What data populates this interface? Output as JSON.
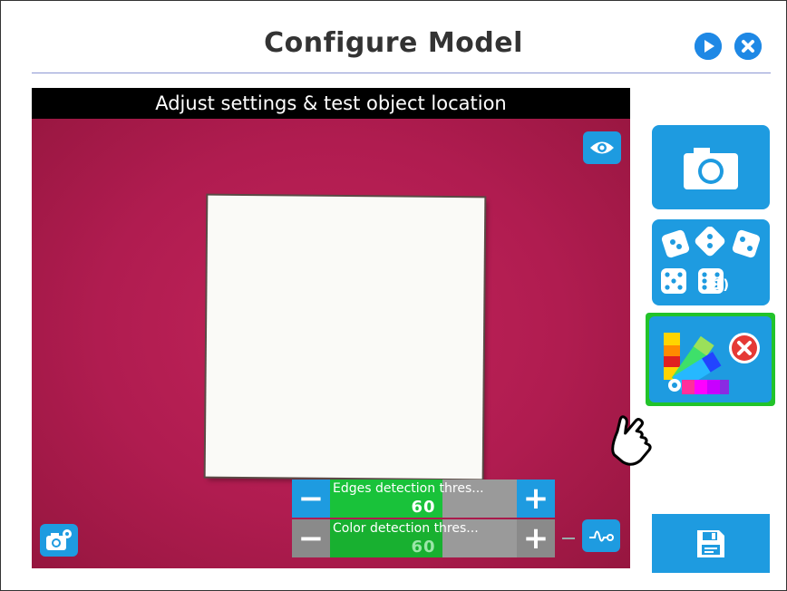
{
  "header": {
    "title": "Configure Model",
    "play_icon": "play-circle-icon",
    "close_icon": "close-circle-icon"
  },
  "camera_view": {
    "caption": "Adjust settings & test object location",
    "view_icon": "eye-icon",
    "camera_settings_icon": "camera-gear-icon",
    "signal_icon": "signal-wave-icon"
  },
  "sliders": {
    "edges": {
      "label": "Edges detection thres...",
      "value": "60",
      "minus": "−",
      "plus": "+"
    },
    "color": {
      "label": "Color detection thres...",
      "value": "60",
      "minus": "−",
      "plus": "+"
    }
  },
  "sidebar": {
    "capture_icon": "camera-icon",
    "poses_icon": "dice-icon",
    "poses_count": "(1)",
    "color_icon": "color-palette-icon",
    "color_remove_icon": "close-circle-icon",
    "save_icon": "floppy-disk-icon"
  },
  "colors": {
    "accent": "#1e9be0",
    "selected_border": "#22c32a",
    "slider_fill": "#19c23a",
    "background_magenta": "#b01c50"
  }
}
